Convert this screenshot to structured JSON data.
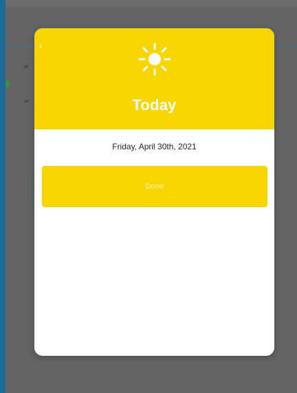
{
  "modal": {
    "title": "Today",
    "date": "Friday, April 30th, 2021",
    "button_label": "Done",
    "header_icon": "sun-icon",
    "back_icon": "chevron-left-icon"
  },
  "colors": {
    "header": "#f8d500",
    "button": "#f8d500",
    "background": "#626466",
    "surface": "#ffffff",
    "title": "#ffffff"
  }
}
